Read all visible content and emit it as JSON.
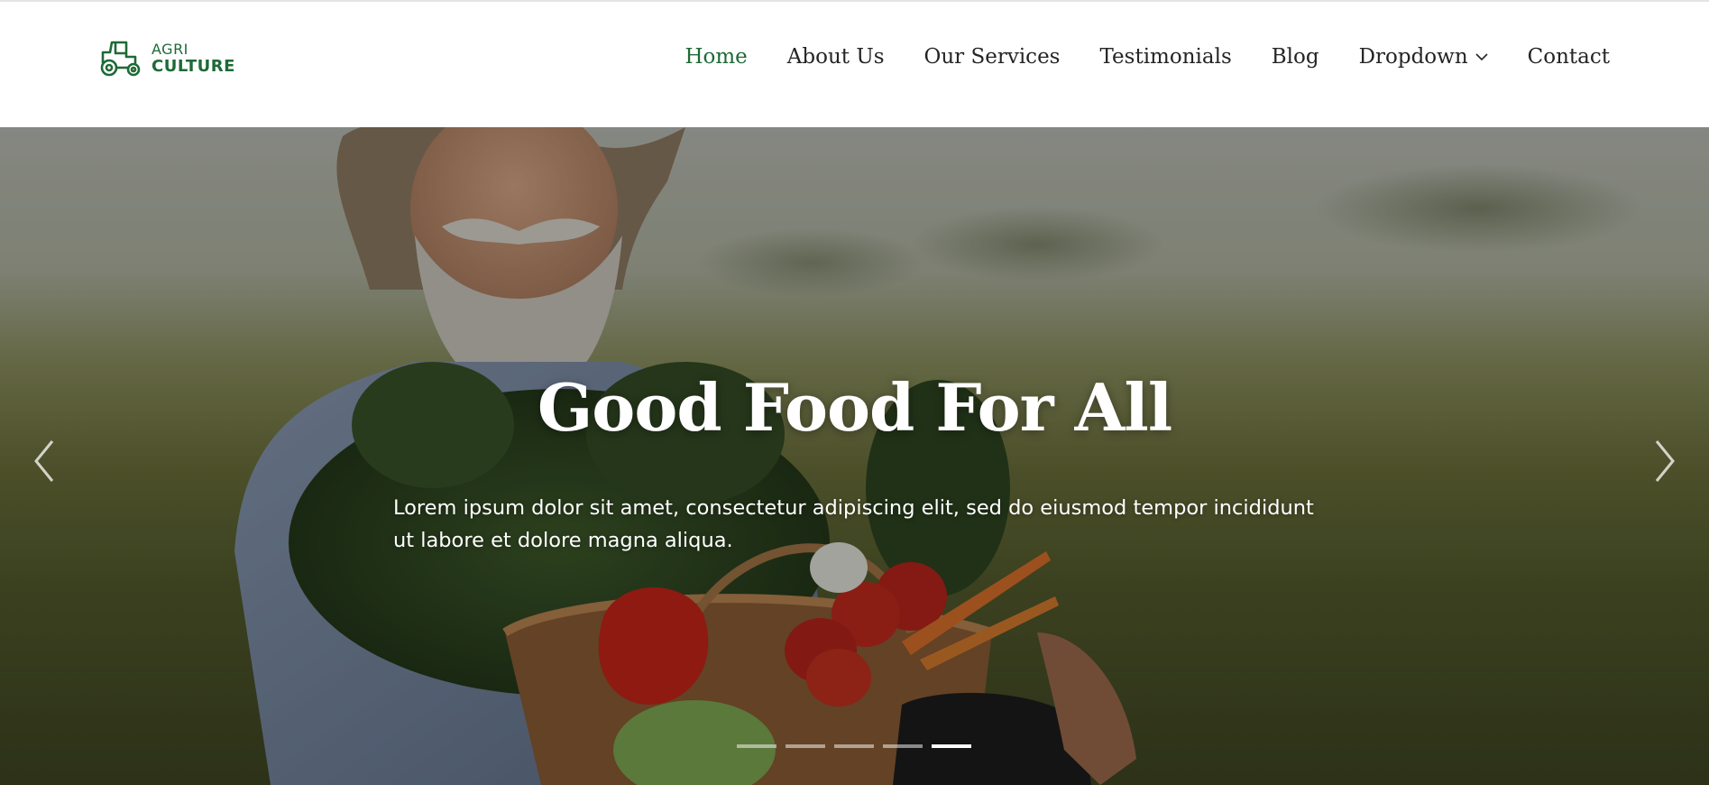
{
  "header": {
    "logo": {
      "line1": "AGRI",
      "line2": "CULTURE",
      "icon": "tractor-icon"
    },
    "nav": [
      {
        "label": "Home",
        "active": true
      },
      {
        "label": "About Us",
        "active": false
      },
      {
        "label": "Our Services",
        "active": false
      },
      {
        "label": "Testimonials",
        "active": false
      },
      {
        "label": "Blog",
        "active": false
      },
      {
        "label": "Dropdown",
        "active": false,
        "icon": "chevron-down-icon"
      },
      {
        "label": "Contact",
        "active": false
      }
    ]
  },
  "hero": {
    "title": "Good Food For All",
    "text": "Lorem ipsum dolor sit amet, consectetur adipiscing elit, sed do eiusmod tempor incididunt ut labore et dolore magna aliqua.",
    "prev_icon": "chevron-left-icon",
    "next_icon": "chevron-right-icon",
    "slide_count": 5,
    "active_slide": 5
  },
  "colors": {
    "brand": "#1e6a37",
    "nav_text": "#252525",
    "hero_text": "#ffffff"
  }
}
